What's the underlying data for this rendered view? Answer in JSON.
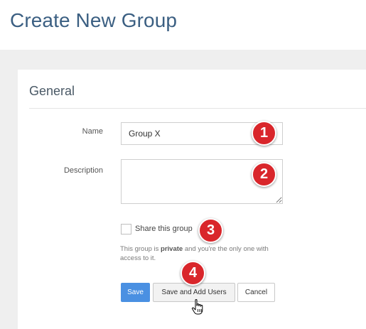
{
  "page": {
    "title": "Create New Group"
  },
  "section": {
    "heading": "General"
  },
  "form": {
    "name_label": "Name",
    "name_value": "Group X",
    "description_label": "Description",
    "description_value": "",
    "share_label": "Share this group",
    "share_checked": false,
    "help_prefix": "This group is ",
    "help_emphasis": "private",
    "help_suffix": " and you're the only one with access to it."
  },
  "buttons": {
    "save": "Save",
    "save_and_add_users": "Save and Add Users",
    "cancel": "Cancel"
  },
  "annotations": {
    "badge_1": "1",
    "badge_2": "2",
    "badge_3": "3",
    "badge_4": "4"
  },
  "colors": {
    "title": "#3b5f82",
    "primary_button": "#4a90e2",
    "badge": "#d9262b",
    "background": "#efefef"
  },
  "icons": {
    "cursor": "hand-pointer-icon"
  }
}
